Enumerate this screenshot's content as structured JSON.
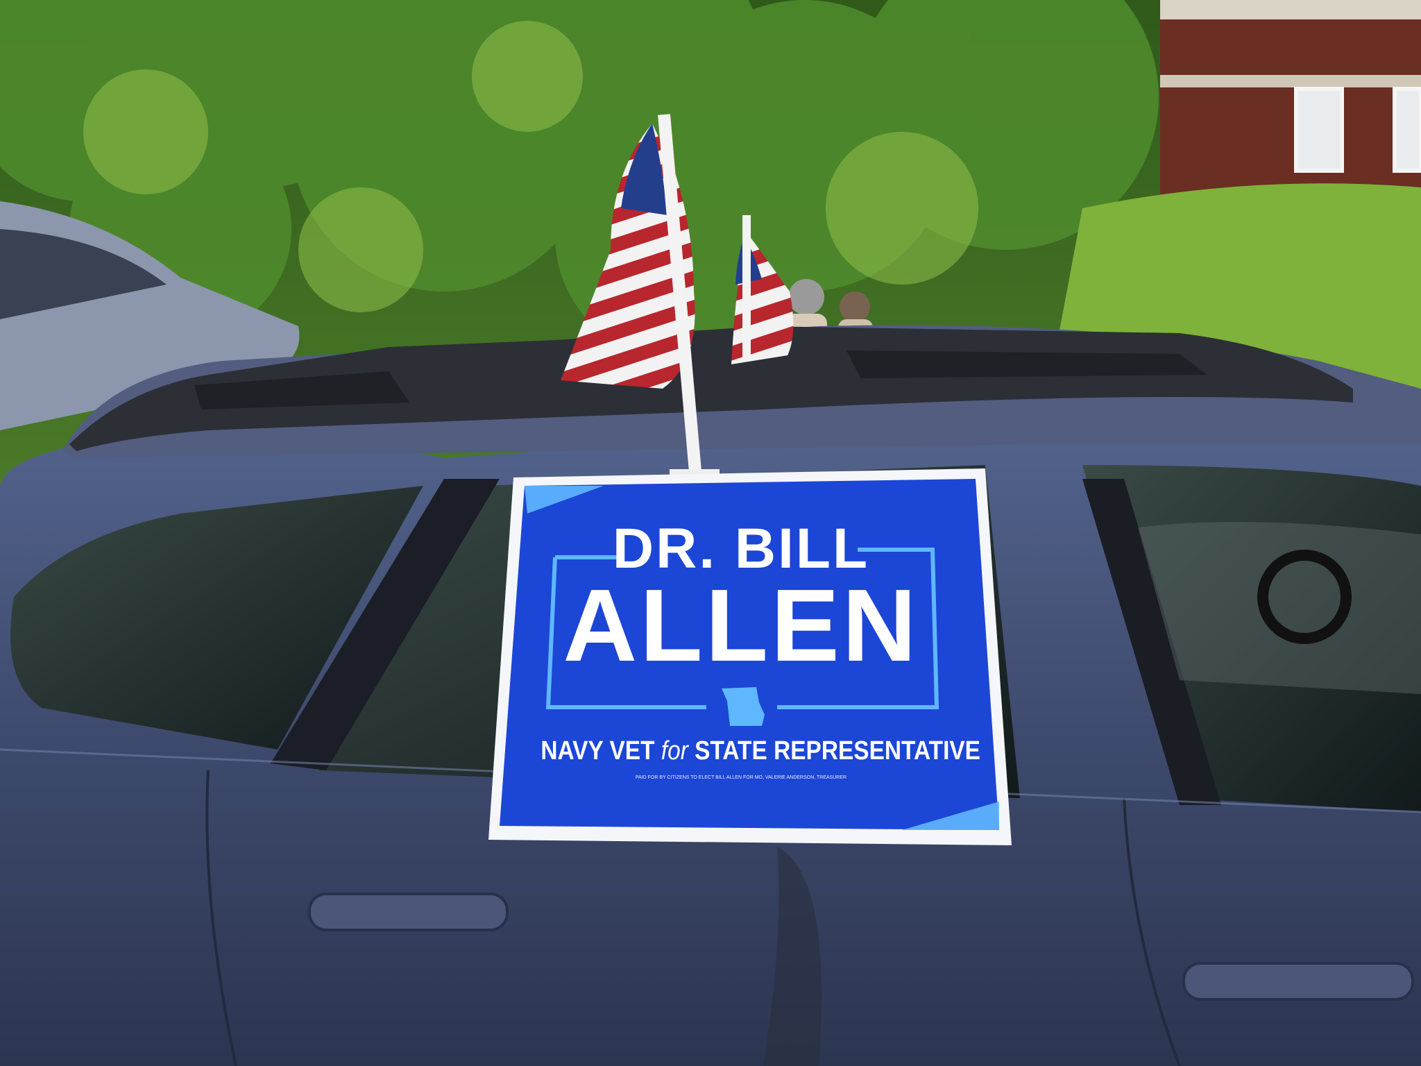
{
  "sign": {
    "line1": "DR. BILL",
    "line2": "ALLEN",
    "tagline_a": "NAVY VET",
    "tagline_for": "for",
    "tagline_b": "STATE REPRESENTATIVE",
    "disclaimer": "PAID FOR BY CITIZENS TO ELECT BILL ALLEN FOR MO, VALERIE ANDERSON, TREASURER"
  },
  "colors": {
    "sign_blue": "#1c46d6",
    "sign_accent": "#5fb7ff",
    "car_body": "#3d4a6e",
    "foliage": "#3f6b22",
    "lawn": "#7fb23a",
    "brick": "#6b2e22"
  },
  "objects": [
    "car-flag-left-icon",
    "car-flag-right-icon",
    "campaign-sign",
    "car",
    "building"
  ]
}
